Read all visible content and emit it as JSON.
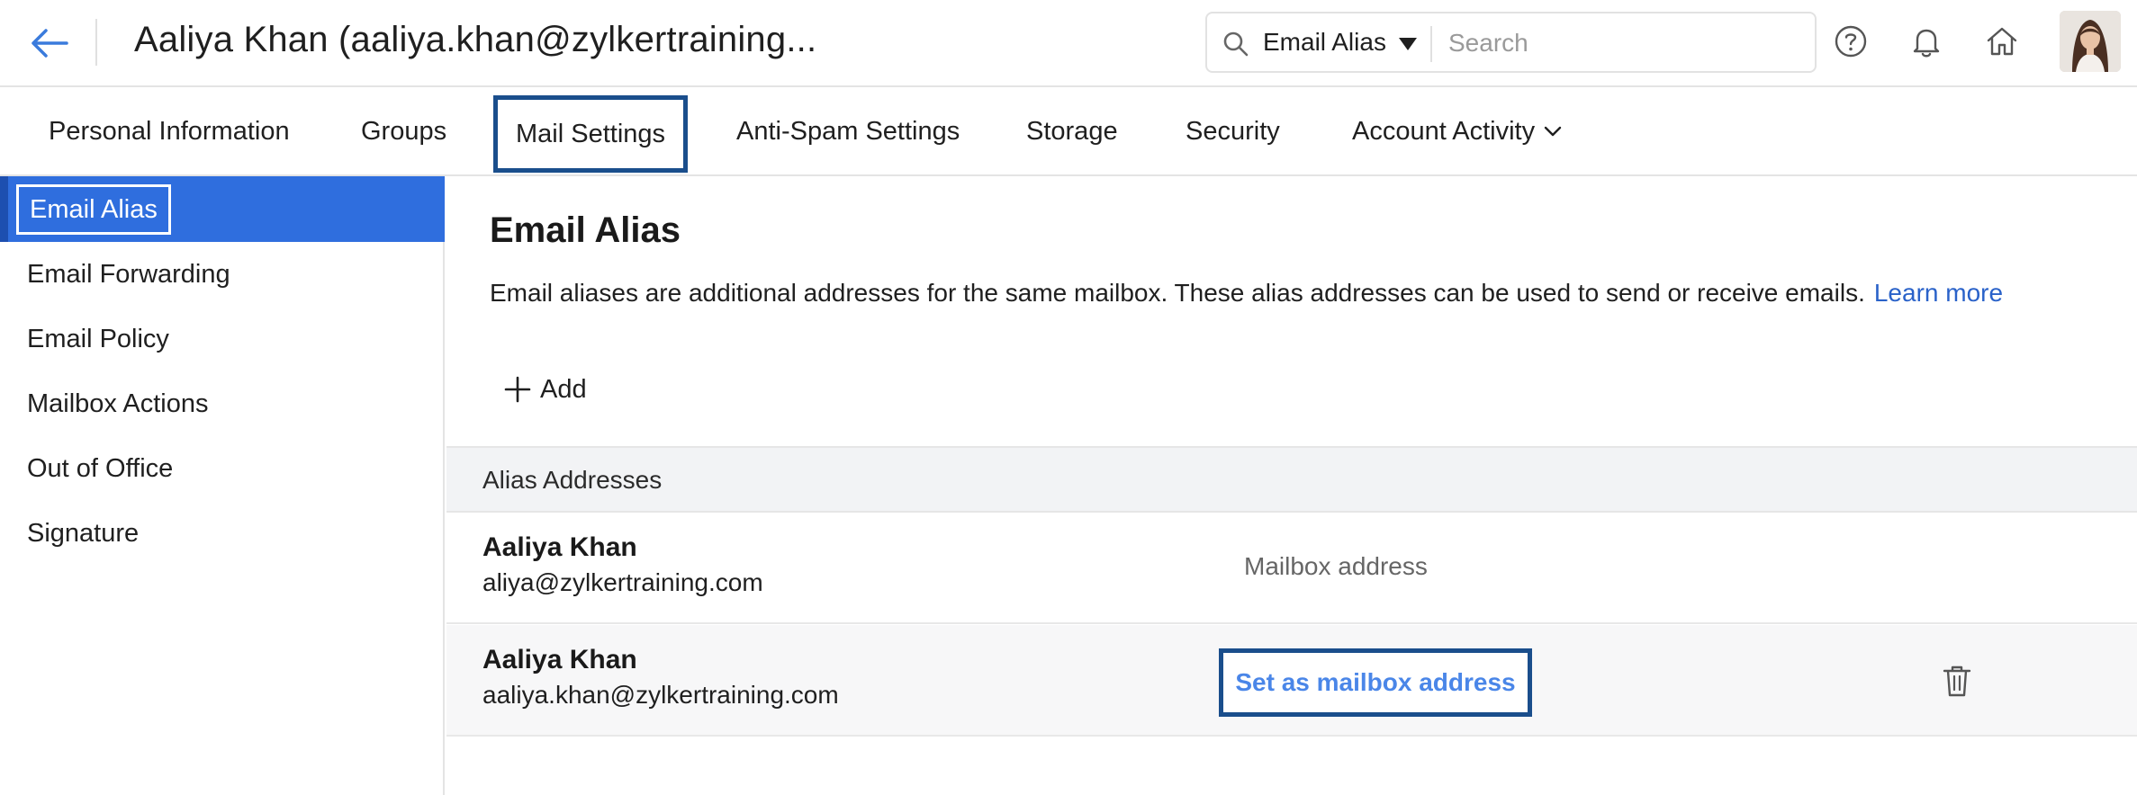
{
  "header": {
    "title": "Aaliya Khan (aaliya.khan@zylkertraining...",
    "search": {
      "scope": "Email Alias",
      "placeholder": "Search"
    },
    "icons": [
      "back-arrow-icon",
      "search-icon",
      "help-icon",
      "bell-icon",
      "home-icon"
    ]
  },
  "tabs": [
    {
      "label": "Personal Information"
    },
    {
      "label": "Groups"
    },
    {
      "label": "Mail Settings",
      "active": true
    },
    {
      "label": "Anti-Spam Settings"
    },
    {
      "label": "Storage"
    },
    {
      "label": "Security"
    },
    {
      "label": "Account Activity"
    }
  ],
  "sidebar": {
    "items": [
      {
        "label": "Email Alias",
        "active": true
      },
      {
        "label": "Email Forwarding"
      },
      {
        "label": "Email Policy"
      },
      {
        "label": "Mailbox Actions"
      },
      {
        "label": "Out of Office"
      },
      {
        "label": "Signature"
      }
    ]
  },
  "main": {
    "title": "Email Alias",
    "description": "Email aliases are additional addresses for the same mailbox. These alias addresses can be used to send or receive emails.",
    "learn_more": "Learn more",
    "add_label": "Add",
    "table": {
      "header": "Alias Addresses",
      "rows": [
        {
          "name": "Aaliya Khan",
          "email": "aliya@zylkertraining.com",
          "status": "Mailbox address"
        },
        {
          "name": "Aaliya Khan",
          "email": "aaliya.khan@zylkertraining.com",
          "action": "Set as mailbox address"
        }
      ]
    }
  },
  "colors": {
    "accent": "#2f6ede",
    "highlight_border": "#1a4e8c",
    "link": "#2a62c9"
  }
}
